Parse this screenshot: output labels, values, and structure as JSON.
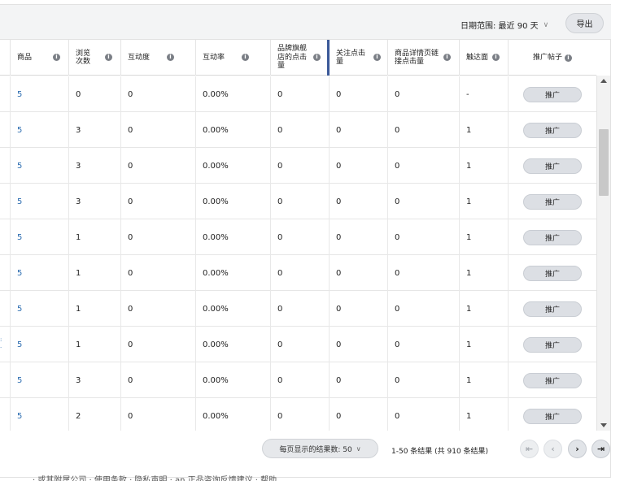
{
  "toolbar": {
    "date_range_label": "日期范围: 最近 90 天",
    "export_label": "导出"
  },
  "info_glyph": "i",
  "columns": [
    {
      "label": "商品"
    },
    {
      "label": "浏览次数"
    },
    {
      "label": "互动度"
    },
    {
      "label": "互动率"
    },
    {
      "label": "品牌旗舰店的点击量"
    },
    {
      "label": "关注点击量"
    },
    {
      "label": "商品详情页链接点击量"
    },
    {
      "label": "触达面"
    },
    {
      "label": "推广帖子"
    }
  ],
  "rows": [
    {
      "products": "5",
      "views": "0",
      "interactions": "0",
      "rate": "0.00%",
      "store_clicks": "0",
      "follow_clicks": "0",
      "detail_clicks": "0",
      "reach": "-",
      "action": "推广"
    },
    {
      "products": "5",
      "views": "3",
      "interactions": "0",
      "rate": "0.00%",
      "store_clicks": "0",
      "follow_clicks": "0",
      "detail_clicks": "0",
      "reach": "1",
      "action": "推广"
    },
    {
      "products": "5",
      "views": "3",
      "interactions": "0",
      "rate": "0.00%",
      "store_clicks": "0",
      "follow_clicks": "0",
      "detail_clicks": "0",
      "reach": "1",
      "action": "推广"
    },
    {
      "products": "5",
      "views": "3",
      "interactions": "0",
      "rate": "0.00%",
      "store_clicks": "0",
      "follow_clicks": "0",
      "detail_clicks": "0",
      "reach": "1",
      "action": "推广"
    },
    {
      "products": "5",
      "views": "1",
      "interactions": "0",
      "rate": "0.00%",
      "store_clicks": "0",
      "follow_clicks": "0",
      "detail_clicks": "0",
      "reach": "1",
      "action": "推广"
    },
    {
      "products": "5",
      "views": "1",
      "interactions": "0",
      "rate": "0.00%",
      "store_clicks": "0",
      "follow_clicks": "0",
      "detail_clicks": "0",
      "reach": "1",
      "action": "推广"
    },
    {
      "products": "5",
      "views": "1",
      "interactions": "0",
      "rate": "0.00%",
      "store_clicks": "0",
      "follow_clicks": "0",
      "detail_clicks": "0",
      "reach": "1",
      "action": "推广"
    },
    {
      "products": "5",
      "views": "1",
      "interactions": "0",
      "rate": "0.00%",
      "store_clicks": "0",
      "follow_clicks": "0",
      "detail_clicks": "0",
      "reach": "1",
      "action": "推广"
    },
    {
      "products": "5",
      "views": "3",
      "interactions": "0",
      "rate": "0.00%",
      "store_clicks": "0",
      "follow_clicks": "0",
      "detail_clicks": "0",
      "reach": "1",
      "action": "推广"
    },
    {
      "products": "5",
      "views": "2",
      "interactions": "0",
      "rate": "0.00%",
      "store_clicks": "0",
      "follow_clicks": "0",
      "detail_clicks": "0",
      "reach": "1",
      "action": "推广"
    }
  ],
  "pagination": {
    "per_page_label": "每页显示的结果数: 50",
    "result_count": "1-50 条结果 (共 910 条结果)",
    "first_icon": "first-page-icon",
    "prev_icon": "prev-page-icon",
    "next_icon": "next-page-icon",
    "last_icon": "last-page-icon"
  },
  "footer": {
    "text": "·   或其附属公司  ·  使用条款  ·  隐私声明  ·  an 正品咨询反馈建议  ·  帮助"
  }
}
